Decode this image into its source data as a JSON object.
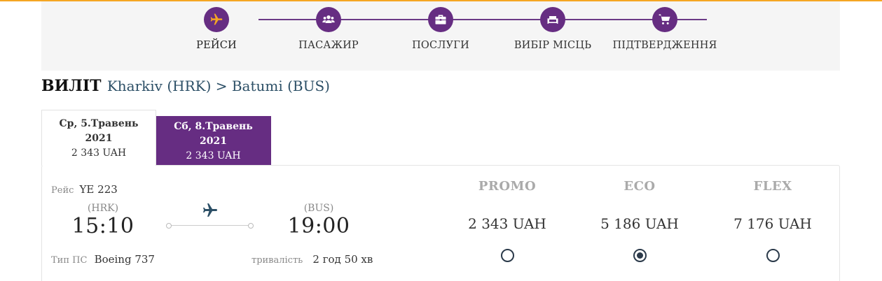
{
  "steps": [
    {
      "label": "РЕЙСИ",
      "icon": "airplane-icon",
      "active": true
    },
    {
      "label": "ПАСАЖИР",
      "icon": "users-icon",
      "active": false
    },
    {
      "label": "ПОСЛУГИ",
      "icon": "briefcase-icon",
      "active": false
    },
    {
      "label": "ВИБІР МІСЦЬ",
      "icon": "seat-icon",
      "active": false
    },
    {
      "label": "ПІДТВЕРДЖЕННЯ",
      "icon": "cart-icon",
      "active": false
    }
  ],
  "route": {
    "direction": "ВИЛІТ",
    "text": "Kharkiv (HRK) > Batumi (BUS)"
  },
  "date_tabs": [
    {
      "date_line1": "Ср, 5.Травень",
      "date_line2": "2021",
      "price": "2 343 UAH",
      "selected": true
    },
    {
      "date_line1": "Сб, 8.Травень",
      "date_line2": "2021",
      "price": "2 343 UAH",
      "selected": false
    }
  ],
  "flight": {
    "flight_label": "Рейс",
    "flight_number": "YE 223",
    "origin_code": "(HRK)",
    "departure_time": "15:10",
    "dest_code": "(BUS)",
    "arrival_time": "19:00",
    "aircraft_label": "Тип ПС",
    "aircraft": "Boeing 737",
    "duration_label": "тривалість",
    "duration": "2 год 50 хв"
  },
  "fares": [
    {
      "name": "PROMO",
      "price": "2 343 UAH",
      "selected": false
    },
    {
      "name": "ECO",
      "price": "5 186 UAH",
      "selected": true
    },
    {
      "name": "FLEX",
      "price": "7 176 UAH",
      "selected": false
    }
  ],
  "colors": {
    "brand_purple": "#662d82",
    "accent_orange": "#f5a623",
    "radio_dark": "#2b3a4a"
  }
}
